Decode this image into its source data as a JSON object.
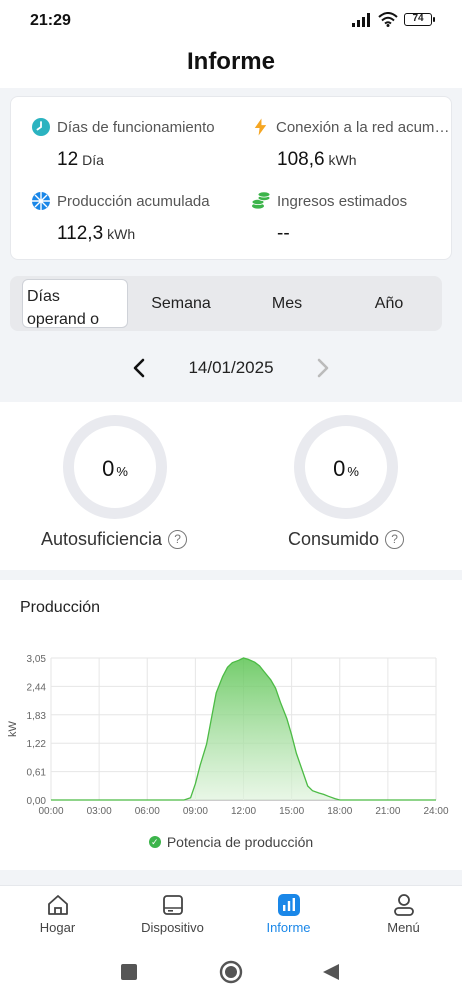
{
  "status_bar": {
    "time": "21:29",
    "battery": "74"
  },
  "header": {
    "title": "Informe"
  },
  "summary": {
    "days": {
      "label": "Días de funcionamiento",
      "value": "12",
      "unit": "Día",
      "icon": "clock-icon",
      "color": "#2bb3c0"
    },
    "grid": {
      "label": "Conexión a la red acumulada",
      "value": "108,6",
      "unit": "kWh",
      "icon": "lightning-icon",
      "color": "#f5a623"
    },
    "production": {
      "label": "Producción acumulada",
      "value": "112,3",
      "unit": "kWh",
      "icon": "solar-panel-icon",
      "color": "#1a87e8"
    },
    "income": {
      "label": "Ingresos estimados",
      "value": "--",
      "unit": "",
      "icon": "coins-icon",
      "color": "#3cb44b"
    }
  },
  "period_tabs": {
    "days": "Días operand o",
    "week": "Semana",
    "month": "Mes",
    "year": "Año",
    "active": "days"
  },
  "date_nav": {
    "date": "14/01/2025"
  },
  "ratios": {
    "self_sufficiency": {
      "value": "0",
      "unit": "%",
      "label": "Autosuficiencia"
    },
    "consumed": {
      "value": "0",
      "unit": "%",
      "label": "Consumido"
    }
  },
  "production_chart": {
    "title": "Producción"
  },
  "chart_data": {
    "type": "area",
    "title": "",
    "xlabel": "",
    "ylabel": "kW",
    "x_ticks": [
      "00:00",
      "03:00",
      "06:00",
      "09:00",
      "12:00",
      "15:00",
      "18:00",
      "21:00",
      "24:00"
    ],
    "y_ticks": [
      "0,00",
      "0,61",
      "1,22",
      "1,83",
      "2,44",
      "3,05"
    ],
    "ylim": [
      0,
      3.05
    ],
    "xlim": [
      0,
      24
    ],
    "grid": true,
    "legend_position": "bottom",
    "series": [
      {
        "name": "Potencia de producción",
        "color": "#4cbb45",
        "x": [
          0,
          7,
          8.3,
          8.7,
          9,
          9.3,
          9.7,
          10,
          10.3,
          10.7,
          11,
          11.3,
          11.7,
          12,
          12.3,
          12.7,
          13,
          13.3,
          13.7,
          14,
          14.3,
          14.7,
          15,
          15.3,
          15.7,
          16,
          16.3,
          16.7,
          17,
          17.3,
          17.7,
          18,
          24
        ],
        "y": [
          0,
          0,
          0,
          0.05,
          0.35,
          0.75,
          1.2,
          1.75,
          2.3,
          2.65,
          2.85,
          2.95,
          3.0,
          3.05,
          3.02,
          2.96,
          2.88,
          2.75,
          2.58,
          2.4,
          2.1,
          1.75,
          1.4,
          1.0,
          0.6,
          0.3,
          0.2,
          0.15,
          0.12,
          0.08,
          0.03,
          0,
          0
        ]
      }
    ]
  },
  "bottom_nav": {
    "home": "Hogar",
    "device": "Dispositivo",
    "report": "Informe",
    "menu": "Menú",
    "active_color": "#1a87e8"
  }
}
